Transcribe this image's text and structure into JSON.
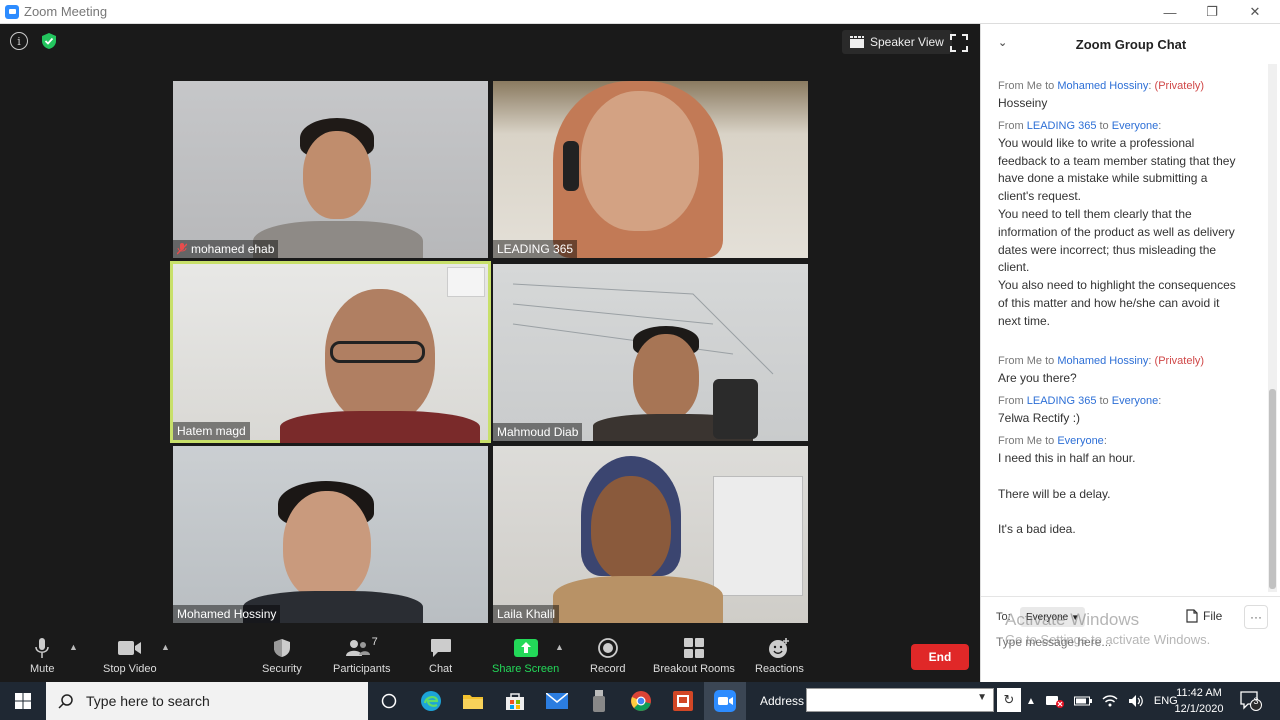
{
  "window": {
    "title": "Zoom Meeting",
    "controls": [
      "—",
      "❐",
      "✕"
    ]
  },
  "video": {
    "info_icon": "i",
    "speaker_view_label": "Speaker View",
    "participants": [
      {
        "name": "mohamed ehab",
        "muted": true
      },
      {
        "name": "LEADING 365",
        "muted": false
      },
      {
        "name": "Hatem magd",
        "muted": false,
        "active_speaker": true
      },
      {
        "name": "Mahmoud Diab",
        "muted": false
      },
      {
        "name": "Mohamed Hossiny",
        "muted": false
      },
      {
        "name": "Laila Khalil",
        "muted": false
      }
    ]
  },
  "toolbar": {
    "mute": "Mute",
    "stop_video": "Stop Video",
    "security": "Security",
    "participants": "Participants",
    "participants_count": "7",
    "chat": "Chat",
    "share_screen": "Share Screen",
    "record": "Record",
    "breakout_rooms": "Breakout Rooms",
    "reactions": "Reactions",
    "end": "End",
    "share_color": "#23d959",
    "end_color": "#e02828"
  },
  "chat": {
    "title": "Zoom Group Chat",
    "messages": [
      {
        "from": "Me",
        "to": "Mohamed Hossiny",
        "private": "(Privately)",
        "text": "Hosseiny"
      },
      {
        "from": "LEADING 365",
        "to": "Everyone",
        "private": "",
        "text": "You would like to write a professional feedback to a team member stating that they have done a mistake while submitting a client's request.\nYou need to tell them clearly that the information of the product as well as delivery dates were incorrect; thus misleading the client.\nYou also need to highlight the consequences of this matter and how he/she can avoid it next time.\n\n"
      },
      {
        "from": "Me",
        "to": "Mohamed Hossiny",
        "private": "(Privately)",
        "text": "Are you there?"
      },
      {
        "from": "LEADING 365",
        "to": "Everyone",
        "private": "",
        "text": "7elwa Rectify :)"
      },
      {
        "from": "Me",
        "to": "Everyone",
        "private": "",
        "text": "I need this in half an hour.\n\nThere will be a delay.\n\nIt's a bad idea."
      }
    ],
    "from_word": "From",
    "to_word": "to",
    "to_label": "To:",
    "to_value": "Everyone",
    "file_label": "File",
    "more_label": "···",
    "input_placeholder": "Type message here...",
    "link_color": "#2d6fd6",
    "private_color": "#d04848"
  },
  "watermark": {
    "line1": "Activate Windows",
    "line2": "Go to Settings to activate Windows."
  },
  "taskbar": {
    "search_placeholder": "Type here to search",
    "address_label": "Address",
    "language": "ENG",
    "time": "11:42 AM",
    "date": "12/1/2020",
    "notification_count": "3"
  }
}
